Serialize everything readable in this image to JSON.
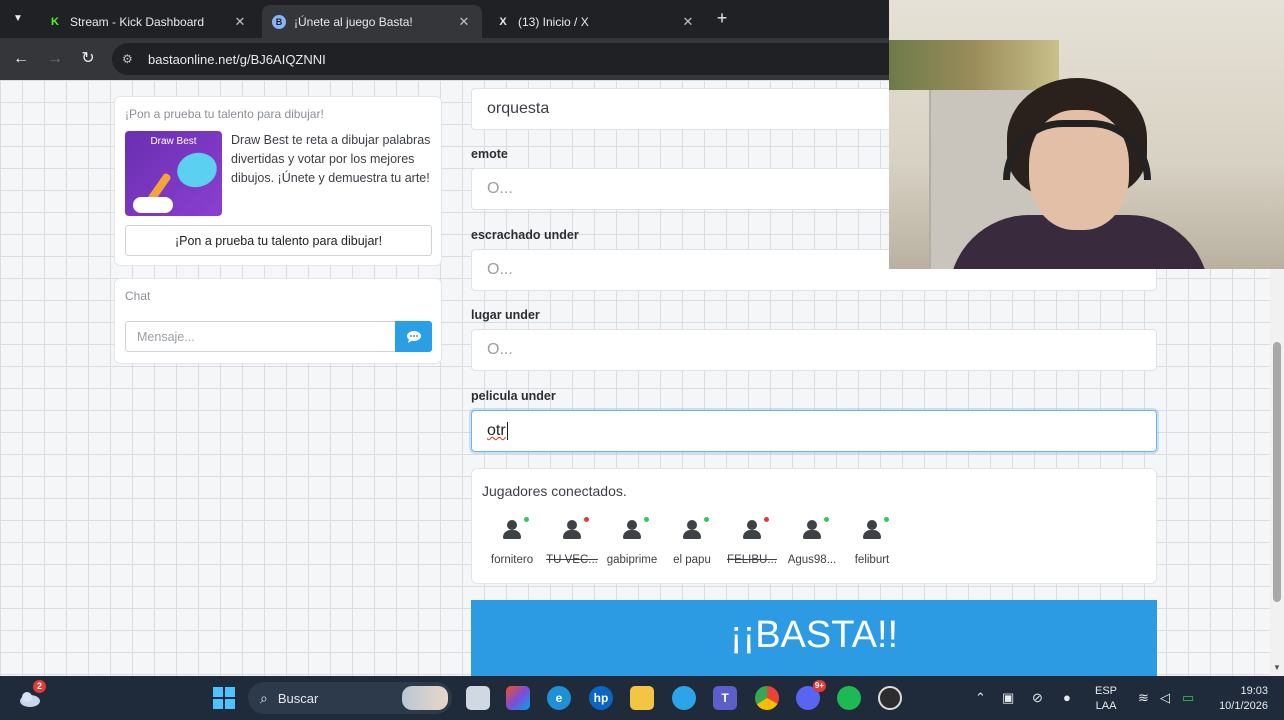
{
  "browser": {
    "tabs": [
      {
        "title": "Stream - Kick Dashboard",
        "icon": "kick-icon",
        "active": false
      },
      {
        "title": "¡Únete al juego Basta!",
        "icon": "basta-icon",
        "active": true
      },
      {
        "title": "(13) Inicio / X",
        "icon": "x-icon",
        "active": false
      }
    ],
    "url": "bastaonline.net/g/BJ6AIQZNNI"
  },
  "promo": {
    "title": "¡Pon a prueba tu talento para dibujar!",
    "image_label": "Draw Best",
    "text": "Draw Best te reta a dibujar palabras divertidas y votar por los mejores dibujos. ¡Únete y demuestra tu arte!",
    "button": "¡Pon a prueba tu talento para dibujar!"
  },
  "chat": {
    "title": "Chat",
    "placeholder": "Mensaje..."
  },
  "form": {
    "top_value": "orquesta",
    "fields": [
      {
        "label": "emote",
        "placeholder": "O..."
      },
      {
        "label": "escrachado under",
        "placeholder": "O..."
      },
      {
        "label": "lugar under",
        "placeholder": "O..."
      },
      {
        "label": "pelicula under",
        "value": "otr"
      }
    ]
  },
  "players": {
    "title": "Jugadores conectados.",
    "list": [
      {
        "name": "fornitero",
        "status": "online",
        "struck": false
      },
      {
        "name": "TU VEC...",
        "status": "offline",
        "struck": true
      },
      {
        "name": "gabiprime",
        "status": "online",
        "struck": false
      },
      {
        "name": "el papu",
        "status": "online",
        "struck": false
      },
      {
        "name": "FELIBU...",
        "status": "offline",
        "struck": true
      },
      {
        "name": "Agus98...",
        "status": "online",
        "struck": false
      },
      {
        "name": "feliburt",
        "status": "online",
        "struck": false
      }
    ]
  },
  "basta_button": "¡¡BASTA!!",
  "taskbar": {
    "search_label": "Buscar",
    "notification_badge": "2",
    "discord_badge": "9+",
    "lang_line1": "ESP",
    "lang_line2": "LAA",
    "time": "19:03",
    "date": "10/1/2026"
  },
  "colors": {
    "accent": "#2c9be4",
    "online": "#34c759",
    "offline": "#e53935"
  }
}
